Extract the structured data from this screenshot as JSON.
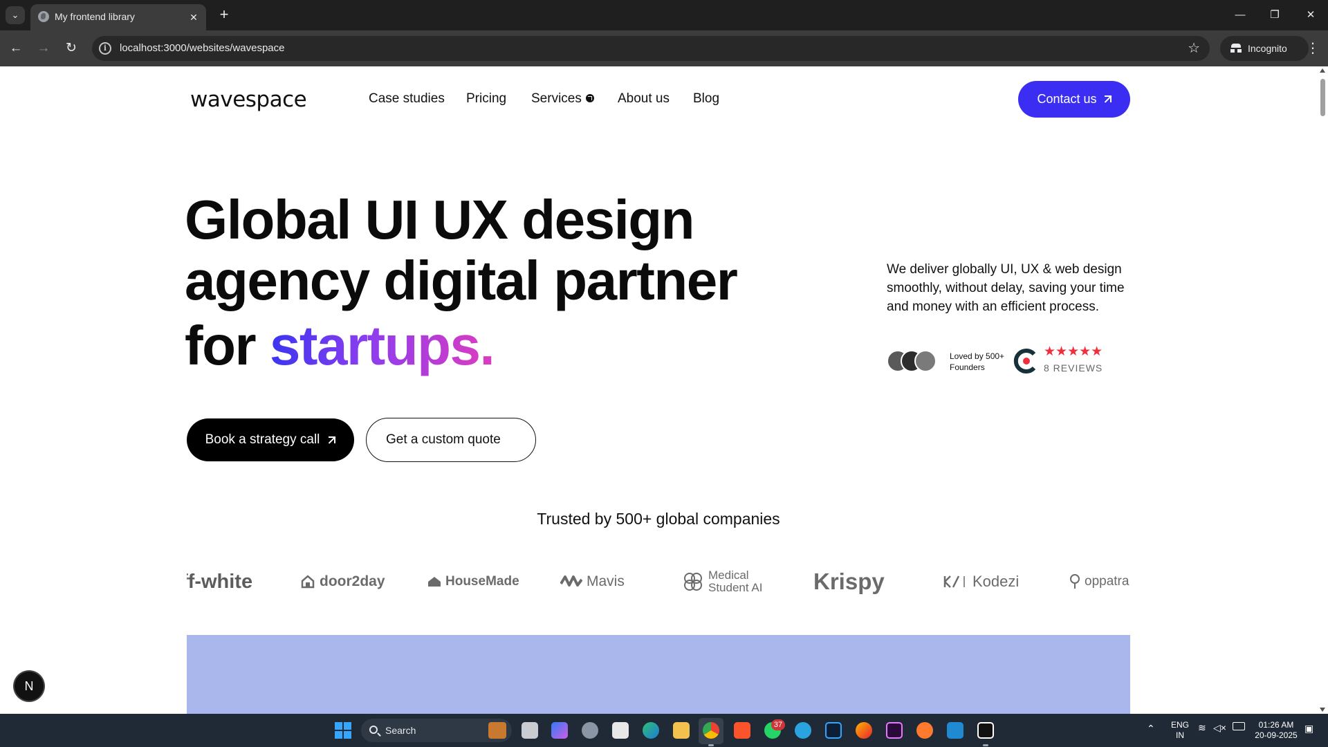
{
  "browser": {
    "tab_title": "My frontend library",
    "url": "localhost:3000/websites/wavespace",
    "profile_label": "Incognito"
  },
  "site": {
    "logo": "wavespace",
    "nav": [
      "Case studies",
      "Pricing",
      "Services",
      "About us",
      "Blog"
    ],
    "contact_label": "Contact us",
    "accent_color": "#3b2df2"
  },
  "hero": {
    "line1": "Global UI UX design",
    "line2": "agency digital partner",
    "line3_prefix": "for ",
    "line3_highlight": "startups",
    "line3_dot": ".",
    "tagline": "We deliver globally UI, UX & web design smoothly, without delay, saving your time and money with an efficient process.",
    "loved_line1": "Loved by 500+",
    "loved_line2": "Founders",
    "stars": "★★★★★",
    "reviews": "8 REVIEWS",
    "primary_cta": "Book a strategy call",
    "secondary_cta": "Get a custom quote"
  },
  "trusted": {
    "heading": "Trusted by 500+ global companies",
    "logos": [
      "ff-white",
      "door2day",
      "HouseMade",
      "Mavis",
      "Medical Student AI",
      "Krispy",
      "Kodezi",
      "oppatra"
    ]
  },
  "floating": {
    "badge": "N"
  },
  "taskbar": {
    "search_label": "Search",
    "whatsapp_badge": "37",
    "lang_line1": "ENG",
    "lang_line2": "IN",
    "time": "01:26 AM",
    "date": "20-09-2025"
  }
}
